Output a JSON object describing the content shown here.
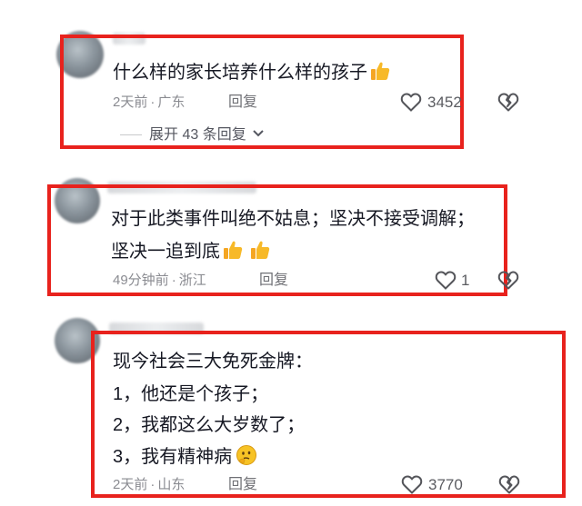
{
  "comments": [
    {
      "text": "什么样的家长培养什么样的孩子",
      "emojis": [
        "thumbs-up-emoji"
      ],
      "time": "2天前",
      "location": "广东",
      "reply_label": "回复",
      "likes": "3452",
      "expand_label": "展开 43 条回复"
    },
    {
      "text_lines": [
        "对于此类事件叫绝不姑息；坚决不接受调解；",
        "坚决一追到底"
      ],
      "emojis": [
        "thumbs-up-emoji",
        "thumbs-up-emoji"
      ],
      "time": "49分钟前",
      "location": "浙江",
      "reply_label": "回复",
      "likes": "1"
    },
    {
      "text_lines": [
        "现今社会三大免死金牌：",
        "1，他还是个孩子；",
        "2，我都这么大岁数了；",
        "3，我有精神病"
      ],
      "emojis": [
        "thinking-emoji"
      ],
      "time": "2天前",
      "location": "山东",
      "reply_label": "回复",
      "likes": "3770"
    }
  ],
  "separator": "·",
  "colors": {
    "highlight_border": "#e8221d",
    "emoji_yellow": "#f7b928"
  }
}
